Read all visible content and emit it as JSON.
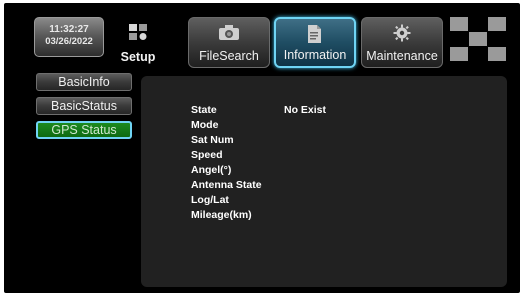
{
  "clock": {
    "time": "11:32:27",
    "date": "03/26/2022"
  },
  "tabs": [
    {
      "label": "Setup",
      "icon": "setup-icon"
    },
    {
      "label": "FileSearch",
      "icon": "camera-icon"
    },
    {
      "label": "Information",
      "icon": "document-icon",
      "active": true
    },
    {
      "label": "Maintenance",
      "icon": "gear-icon"
    }
  ],
  "sidebar": {
    "items": [
      {
        "label": "BasicInfo"
      },
      {
        "label": "BasicStatus"
      },
      {
        "label": "GPS Status",
        "active": true
      }
    ]
  },
  "gps": {
    "fields": [
      {
        "label": "State",
        "value": "No Exist"
      },
      {
        "label": "Mode",
        "value": ""
      },
      {
        "label": "Sat Num",
        "value": ""
      },
      {
        "label": "Speed",
        "value": ""
      },
      {
        "label": "Angel(°)",
        "value": ""
      },
      {
        "label": "Antenna State",
        "value": ""
      },
      {
        "label": "Log/Lat",
        "value": ""
      },
      {
        "label": "Mileage(km)",
        "value": ""
      }
    ]
  },
  "colors": {
    "background": "#000000",
    "panel": "#212121",
    "active_border": "#6fd4f4",
    "active_sidebar": "#1c8a1f"
  }
}
